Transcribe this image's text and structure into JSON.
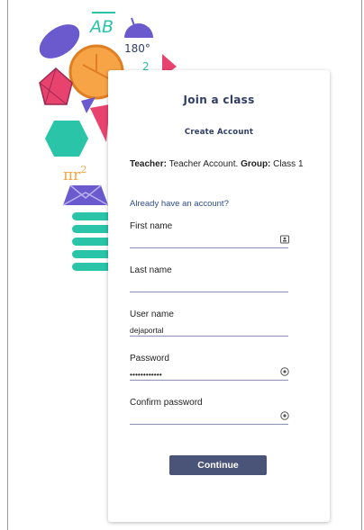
{
  "decor": {
    "segment_label": "AB",
    "angle_label": "180°",
    "formula_base": "πr",
    "formula_exp": "2",
    "digit": "2"
  },
  "card": {
    "title": "Join a class",
    "subtitle": "Create Account",
    "info": {
      "teacher_label": "Teacher:",
      "teacher_value": "Teacher Account",
      "separator": ".",
      "group_label": "Group:",
      "group_value": "Class 1"
    },
    "already_link": "Already have an account?",
    "fields": {
      "first_name": {
        "label": "First name",
        "value": ""
      },
      "last_name": {
        "label": "Last name",
        "value": ""
      },
      "user_name": {
        "label": "User name",
        "value": "dejaportal"
      },
      "password": {
        "label": "Password",
        "value": "••••••••••••"
      },
      "confirm_password": {
        "label": "Confirm password",
        "value": ""
      }
    },
    "continue_label": "Continue"
  },
  "colors": {
    "title": "#2f3d66",
    "button": "#4a5378",
    "link": "#2f4e8c",
    "teal": "#2ac4a8",
    "orange": "#f6a445",
    "purple": "#6a5acd",
    "pink": "#e8426e"
  },
  "icons": {
    "first_name": "contact-card-icon",
    "password": "eye-icon",
    "confirm_password": "eye-icon"
  }
}
